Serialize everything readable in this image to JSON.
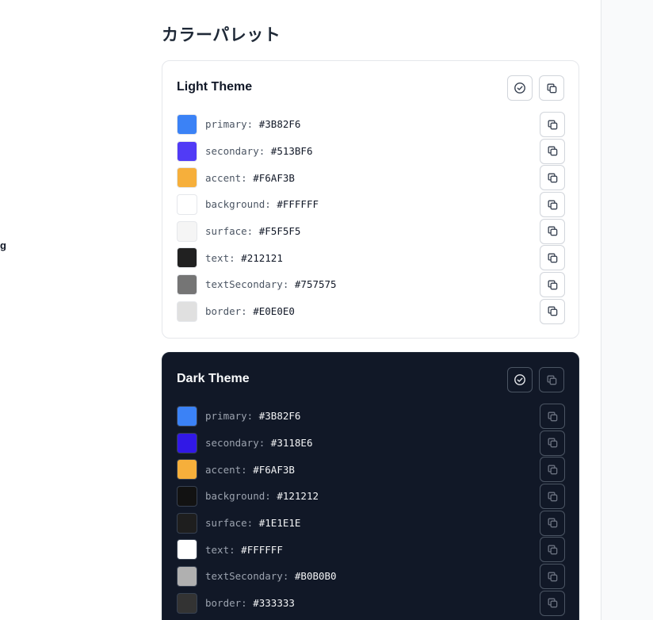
{
  "page": {
    "title": "カラーパレット",
    "left_edge_text": "g"
  },
  "light_theme": {
    "title": "Light Theme",
    "colors": [
      {
        "key": "primary:",
        "value": "#3B82F6",
        "swatch": "#3B82F6"
      },
      {
        "key": "secondary:",
        "value": "#513BF6",
        "swatch": "#513BF6"
      },
      {
        "key": "accent:",
        "value": "#F6AF3B",
        "swatch": "#F6AF3B"
      },
      {
        "key": "background:",
        "value": "#FFFFFF",
        "swatch": "#FFFFFF"
      },
      {
        "key": "surface:",
        "value": "#F5F5F5",
        "swatch": "#F5F5F5"
      },
      {
        "key": "text:",
        "value": "#212121",
        "swatch": "#212121"
      },
      {
        "key": "textSecondary:",
        "value": "#757575",
        "swatch": "#757575"
      },
      {
        "key": "border:",
        "value": "#E0E0E0",
        "swatch": "#E0E0E0"
      }
    ]
  },
  "dark_theme": {
    "title": "Dark Theme",
    "colors": [
      {
        "key": "primary:",
        "value": "#3B82F6",
        "swatch": "#3B82F6"
      },
      {
        "key": "secondary:",
        "value": "#3118E6",
        "swatch": "#3118E6"
      },
      {
        "key": "accent:",
        "value": "#F6AF3B",
        "swatch": "#F6AF3B"
      },
      {
        "key": "background:",
        "value": "#121212",
        "swatch": "#121212"
      },
      {
        "key": "surface:",
        "value": "#1E1E1E",
        "swatch": "#1E1E1E"
      },
      {
        "key": "text:",
        "value": "#FFFFFF",
        "swatch": "#FFFFFF"
      },
      {
        "key": "textSecondary:",
        "value": "#B0B0B0",
        "swatch": "#B0B0B0"
      },
      {
        "key": "border:",
        "value": "#333333",
        "swatch": "#333333"
      }
    ]
  },
  "icons": {
    "header_check": "check-circle-icon",
    "copy": "copy-icon"
  }
}
